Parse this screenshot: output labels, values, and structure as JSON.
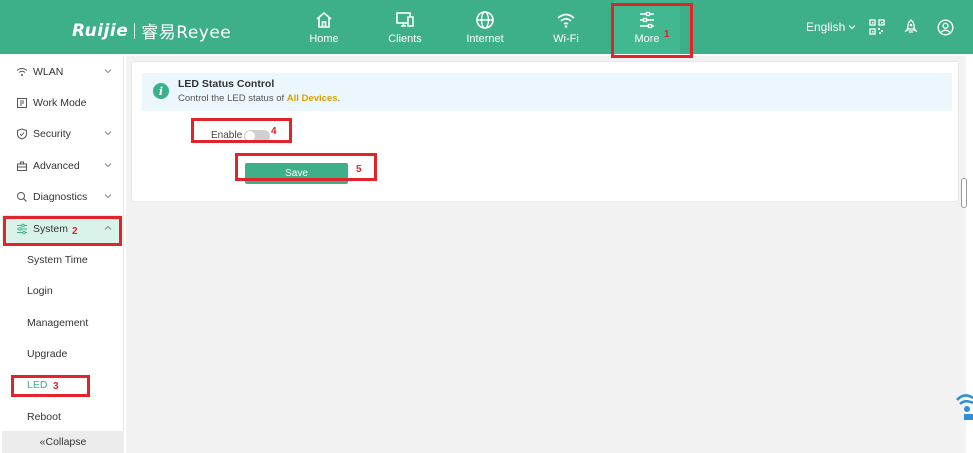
{
  "brand": {
    "name": "Ruijie",
    "sub": "Reyee",
    "sub_prefix": "睿易"
  },
  "nav": [
    {
      "label": "Home",
      "icon": "home-icon"
    },
    {
      "label": "Clients",
      "icon": "monitor-icon"
    },
    {
      "label": "Internet",
      "icon": "globe-icon"
    },
    {
      "label": "Wi-Fi",
      "icon": "wifi-icon"
    },
    {
      "label": "More",
      "icon": "sliders-icon"
    }
  ],
  "header_right": {
    "language": "English",
    "icons": [
      "qr-code-icon",
      "rocket-icon",
      "user-icon"
    ]
  },
  "sidebar": {
    "items": [
      {
        "label": "WLAN",
        "icon": "wifi-icon"
      },
      {
        "label": "Work Mode",
        "icon": "mode-icon"
      },
      {
        "label": "Security",
        "icon": "shield-icon"
      },
      {
        "label": "Advanced",
        "icon": "toolbox-icon"
      },
      {
        "label": "Diagnostics",
        "icon": "search-icon"
      },
      {
        "label": "System",
        "icon": "sliders-icon"
      }
    ],
    "sub_items": [
      "System Time",
      "Login",
      "Management",
      "Upgrade",
      "LED",
      "Reboot"
    ],
    "collapse_label": "Collapse"
  },
  "content": {
    "info_title": "LED Status Control",
    "info_desc_prefix": "Control the LED status of ",
    "info_desc_highlight": "All Devices",
    "info_desc_suffix": ".",
    "enable_label": "Enable",
    "enable_state": false,
    "save_label": "Save"
  },
  "annotations": [
    "1",
    "2",
    "3",
    "4",
    "5"
  ],
  "colors": {
    "primary": "#3db08a",
    "annotation": "#e0242a",
    "highlight": "#d6a200"
  }
}
